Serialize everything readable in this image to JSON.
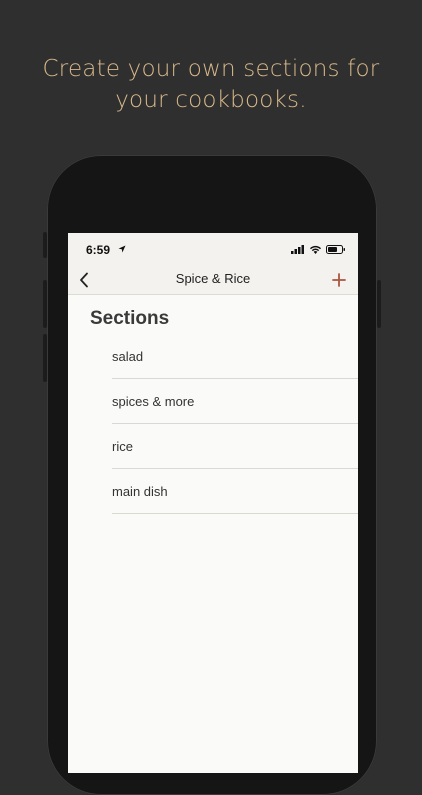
{
  "promo": {
    "line1": "Create your own sections for",
    "line2": "your cookbooks."
  },
  "status_bar": {
    "time": "6:59",
    "icons": [
      "location-arrow-icon",
      "cellular-signal-icon",
      "wifi-icon",
      "battery-icon"
    ]
  },
  "nav": {
    "back_icon": "chevron-left-icon",
    "title": "Spice & Rice",
    "add_icon": "plus-icon"
  },
  "sections": {
    "heading": "Sections",
    "items": [
      {
        "label": "salad"
      },
      {
        "label": "spices & more"
      },
      {
        "label": "rice"
      },
      {
        "label": "main dish"
      }
    ]
  },
  "colors": {
    "background": "#2f2f2f",
    "promo_text": "#d8b98a",
    "accent": "#a8563f",
    "navbar": "#f3f2ee",
    "screen": "#fafaf8"
  }
}
